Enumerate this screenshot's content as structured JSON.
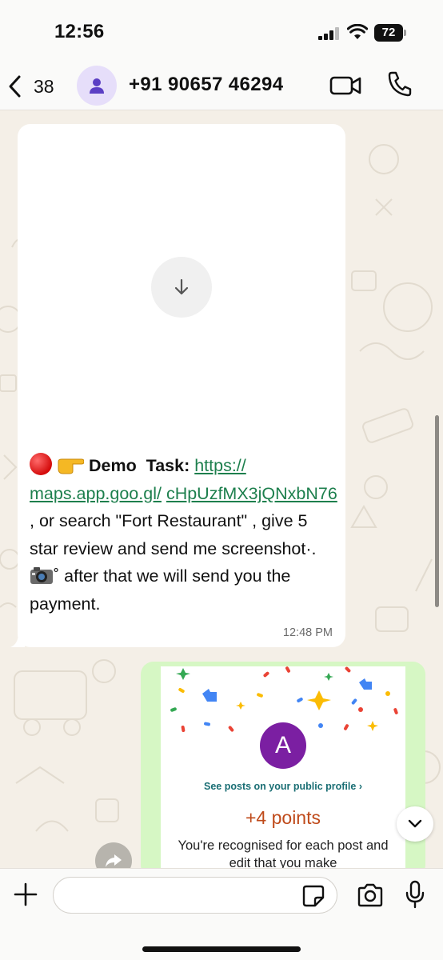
{
  "status_bar": {
    "time": "12:56",
    "battery": "72"
  },
  "header": {
    "back_count": "38",
    "contact_name": "+91 90657 46294",
    "icons": {
      "back": "chevron-left-icon",
      "avatar": "person-icon",
      "video": "video-camera-icon",
      "call": "phone-icon"
    }
  },
  "colors": {
    "header_bg": "#fafaf9",
    "wallpaper": "#f4efe7",
    "incoming_bubble": "#ffffff",
    "outgoing_bubble": "#d6f7c4",
    "link": "#1d7f4d",
    "avatar_bg": "#e6defa",
    "avatar_icon": "#5b3fc4"
  },
  "messages": {
    "incoming": {
      "label_demo": "Demo",
      "label_task": "Task:",
      "link_line1": "https://",
      "link_line2": "maps.app.goo.gl/",
      "link_line3": "cHpUzfMX3jQNxbN76",
      "text_after_link": " , or search \"Fort Restaurant\" , give 5 star review and send me screenshot",
      "text_decor1": "·.",
      "text_decor2": "˚",
      "text_end": " after that we will send you the payment.",
      "time": "12:48 PM",
      "icons": {
        "download": "download-arrow-icon",
        "emoji_1": "red-circle-emoji",
        "emoji_2": "pointing-finger-emoji",
        "emoji_3": "camera-emoji"
      }
    },
    "outgoing_image": {
      "avatar_letter": "A",
      "profile_link": "See posts on your public profile",
      "points": "+4 points",
      "description": "You're recognised for each post and edit that you make"
    }
  },
  "composer": {
    "placeholder": "",
    "icons": {
      "plus": "plus-icon",
      "sticker": "sticker-icon",
      "camera": "camera-icon",
      "mic": "microphone-icon"
    }
  }
}
